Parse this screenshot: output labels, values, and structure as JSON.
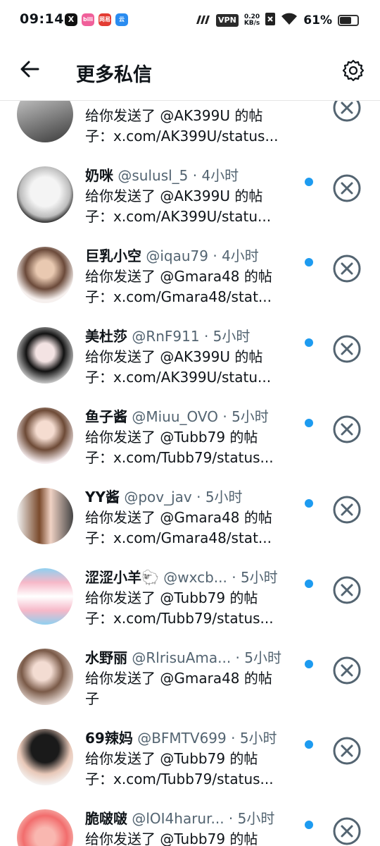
{
  "status_bar": {
    "time": "09:14",
    "apps": [
      "X",
      "bili",
      "网易",
      "云"
    ],
    "vpn": "VPN",
    "speed_value": "0.20",
    "speed_unit": "KB/s",
    "battery": "61%"
  },
  "header": {
    "title": "更多私信",
    "back_icon": "arrow-left-icon",
    "settings_icon": "gear-icon"
  },
  "colors": {
    "unread_dot": "#1d9bf0",
    "handle": "#536471",
    "close_ring": "#536471"
  },
  "messages": [
    {
      "name": "",
      "handle": "",
      "time": "",
      "line_a": "给你发送了 @AK399U 的帖",
      "line_b": "子：x.com/AK399U/status...",
      "unread": false
    },
    {
      "name": "奶咪",
      "handle": "@sulusl_5",
      "time": " · 4小时",
      "line_a": "给你发送了 @AK399U 的帖",
      "line_b": "子：x.com/AK399U/statu...",
      "unread": true
    },
    {
      "name": "巨乳小空",
      "handle": "@iqau79",
      "time": " · 4小时",
      "line_a": "给你发送了 @Gmara48 的帖",
      "line_b": "子：x.com/Gmara48/stat...",
      "unread": true
    },
    {
      "name": "美杜莎",
      "handle": "@RnF911",
      "time": " · 5小时",
      "line_a": "给你发送了 @AK399U 的帖",
      "line_b": "子：x.com/AK399U/statu...",
      "unread": true
    },
    {
      "name": "鱼子酱",
      "handle": "@Miuu_OVO",
      "time": " · 5小时",
      "line_a": "给你发送了 @Tubb79 的帖",
      "line_b": "子：x.com/Tubb79/status...",
      "unread": true
    },
    {
      "name": "YY酱",
      "handle": "@pov_jav",
      "time": " · 5小时",
      "line_a": "给你发送了 @Gmara48 的帖",
      "line_b": "子：x.com/Gmara48/stat...",
      "unread": true
    },
    {
      "name": "涩涩小羊🐑",
      "handle": "@wxcb...",
      "time": " · 5小时",
      "line_a": "给你发送了 @Tubb79 的帖",
      "line_b": "子：x.com/Tubb79/status...",
      "unread": true
    },
    {
      "name": "水野丽",
      "handle": "@RlrisuAma...",
      "time": " · 5小时",
      "line_a": "给你发送了 @Gmara48 的帖",
      "line_b": "子",
      "unread": true
    },
    {
      "name": "69辣妈",
      "handle": "@BFMTV699",
      "time": " · 5小时",
      "line_a": "给你发送了 @Tubb79 的帖",
      "line_b": "子：x.com/Tubb79/status...",
      "unread": true
    },
    {
      "name": "脆啵啵",
      "handle": "@lOI4harur...",
      "time": " · 5小时",
      "line_a": "给你发送了 @Tubb79 的帖",
      "line_b": "",
      "unread": true
    }
  ]
}
